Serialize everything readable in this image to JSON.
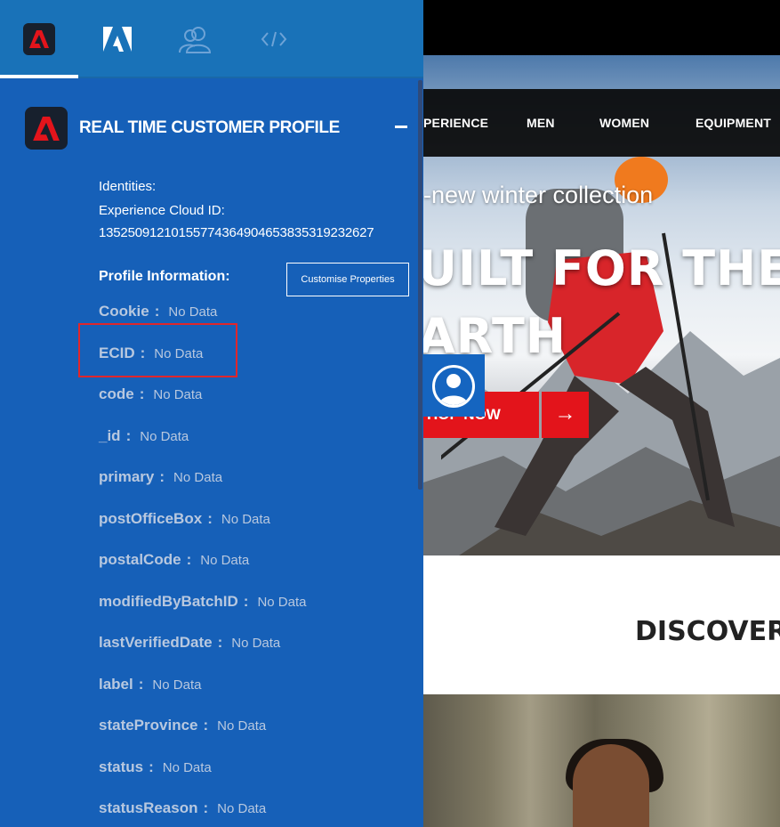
{
  "tabs": [
    {
      "name": "adobe-experience-platform-tab",
      "icon": "adobe-red-logo-icon"
    },
    {
      "name": "adobe-tab",
      "icon": "adobe-logo-icon"
    },
    {
      "name": "profile-tab",
      "icon": "users-icon"
    },
    {
      "name": "code-tab",
      "icon": "code-icon"
    }
  ],
  "panel": {
    "title": "REAL TIME CUSTOMER PROFILE",
    "identities_label": "Identities:",
    "ecid_label": "Experience Cloud ID:",
    "ecid_value": "13525091210155774364904653835319232627",
    "profile_info_label": "Profile Information:",
    "customise_button": "Customise Properties",
    "properties": [
      {
        "key": "Cookie",
        "value": "No Data"
      },
      {
        "key": "ECID",
        "value": "No Data"
      },
      {
        "key": "code",
        "value": "No Data"
      },
      {
        "key": "_id",
        "value": "No Data"
      },
      {
        "key": "primary",
        "value": "No Data"
      },
      {
        "key": "postOfficeBox",
        "value": "No Data"
      },
      {
        "key": "postalCode",
        "value": "No Data"
      },
      {
        "key": "modifiedByBatchID",
        "value": "No Data"
      },
      {
        "key": "lastVerifiedDate",
        "value": "No Data"
      },
      {
        "key": "label",
        "value": "No Data"
      },
      {
        "key": "stateProvince",
        "value": "No Data"
      },
      {
        "key": "status",
        "value": "No Data"
      },
      {
        "key": "statusReason",
        "value": "No Data"
      }
    ],
    "separator": ":"
  },
  "site": {
    "nav": [
      "PERIENCE",
      "MEN",
      "WOMEN",
      "EQUIPMENT"
    ],
    "tagline": "-new winter collection",
    "headline_line1": "UILT FOR THE",
    "headline_line2": "ARTH",
    "shop_button": "HOP NOW",
    "arrow_button": "→",
    "discover": "DISCOVER"
  },
  "colors": {
    "panel_bg": "#1660b8",
    "tabbar_bg": "#1972b8",
    "adobe_red": "#e3141b",
    "highlight": "#e0262b"
  }
}
